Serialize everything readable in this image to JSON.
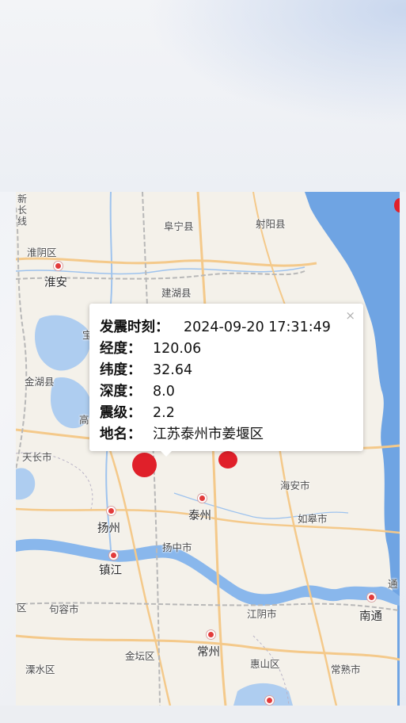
{
  "popup": {
    "close_glyph": "×",
    "rows": [
      {
        "key": "发震时刻：",
        "value": "2024-09-20 17:31:49"
      },
      {
        "key": "经度：",
        "value": "120.06"
      },
      {
        "key": "纬度：",
        "value": "32.64"
      },
      {
        "key": "深度：",
        "value": "8.0"
      },
      {
        "key": "震级：",
        "value": "2.2"
      },
      {
        "key": "地名：",
        "value": "江苏泰州市姜堰区"
      }
    ]
  },
  "places": {
    "xinchang": "新长线",
    "huaiyin": "淮阴区",
    "huaian": "淮安",
    "funing": "阜宁县",
    "sheyang": "射阳县",
    "jianhu": "建湖县",
    "jinhu": "金湖县",
    "gao": "高",
    "bao": "宝",
    "tianchang": "天长市",
    "yangzhou": "扬州",
    "taizhou": "泰州",
    "haian": "海安市",
    "rugao": "如皋市",
    "yangzhong": "扬中市",
    "zhenjiang": "镇江",
    "jurong": "句容市",
    "jiangyin": "江阴市",
    "nantong": "南通",
    "jintan": "金坛区",
    "changzhou": "常州",
    "huishan": "惠山区",
    "changshu": "常熟市",
    "lishui": "溧水区",
    "qu": "区",
    "tong": "通"
  },
  "colors": {
    "sea": "#6fa4e3",
    "lake": "#aecdf0",
    "river": "#89b7ec",
    "road_major": "#f4c98a",
    "rail": "#b8b8b8",
    "quake": "#e0202a",
    "city_dot": "#e23b3b"
  }
}
